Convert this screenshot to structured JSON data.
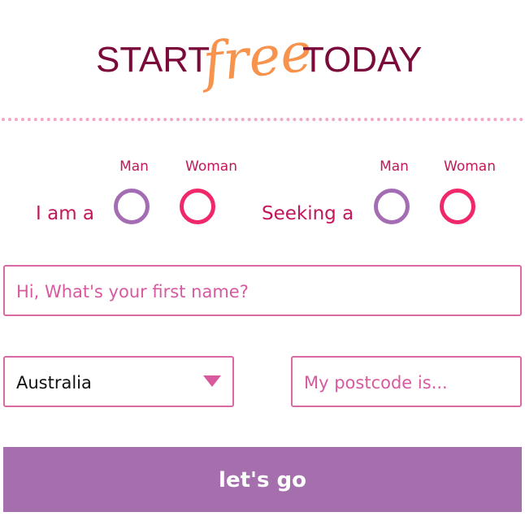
{
  "headline": {
    "start": "START",
    "free": "free",
    "today": "TODAY"
  },
  "i_am": {
    "label": "I am a",
    "options": [
      "Man",
      "Woman"
    ]
  },
  "seeking": {
    "label": "Seeking a",
    "options": [
      "Man",
      "Woman"
    ]
  },
  "first_name": {
    "placeholder": "Hi, What's your first name?"
  },
  "country": {
    "selected": "Australia"
  },
  "postcode": {
    "placeholder": "My postcode is..."
  },
  "submit": {
    "label": "let's go"
  },
  "colors": {
    "headline": "#7a0a3a",
    "accent_free": "#f7934c",
    "label": "#c2185b",
    "man_radio": "#a36cb3",
    "woman_radio": "#f0286a",
    "field_border": "#d96aa3",
    "button_bg": "#a56fae"
  },
  "icons": {
    "select_caret": "triangle-down-icon"
  }
}
